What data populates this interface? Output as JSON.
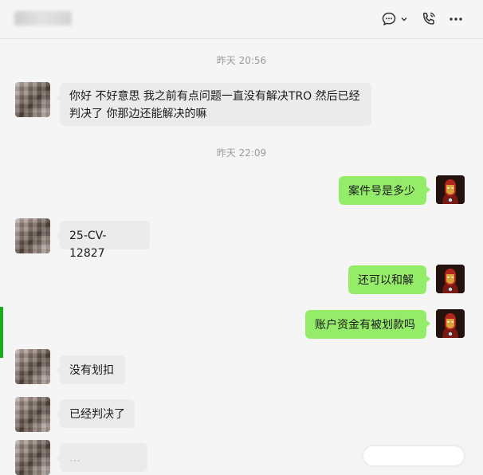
{
  "header": {
    "chat_icon": "chat-bubble-icon",
    "chevron_icon": "chevron-down-icon",
    "call_icon": "phone-call-icon",
    "more_icon": "more-dots-icon"
  },
  "timestamps": {
    "first": "昨天 20:56",
    "second": "昨天 22:09"
  },
  "messages": [
    {
      "side": "in",
      "line1": "你好 不好意思 我之前有点问题一直没有解决TRO  然后已经",
      "line2": "判决了 你那边还能解决的嘛"
    },
    {
      "side": "out",
      "text": "案件号是多少"
    },
    {
      "side": "in",
      "text": "25-CV-12827"
    },
    {
      "side": "out",
      "text": "还可以和解"
    },
    {
      "side": "out",
      "text": "账户资金有被划款吗"
    },
    {
      "side": "in",
      "text": "没有划扣"
    },
    {
      "side": "in",
      "text": "已经判决了"
    },
    {
      "side": "in",
      "text": "…"
    }
  ],
  "colors": {
    "incoming_bubble": "#ebebeb",
    "outgoing_bubble": "#95ec69",
    "accent": "#1aad19"
  }
}
